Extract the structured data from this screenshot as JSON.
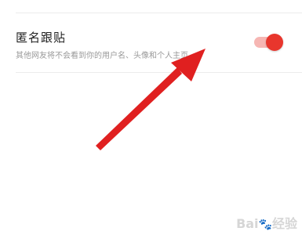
{
  "setting": {
    "title": "匿名跟贴",
    "description": "其他网友将不会看到你的用户名、头像和个人主页",
    "toggle_on": true
  },
  "colors": {
    "accent": "#e8362d",
    "track": "#f6b6b3",
    "arrow": "#e02020"
  },
  "watermark": {
    "brand_left": "Bai",
    "brand_right": "经验"
  }
}
